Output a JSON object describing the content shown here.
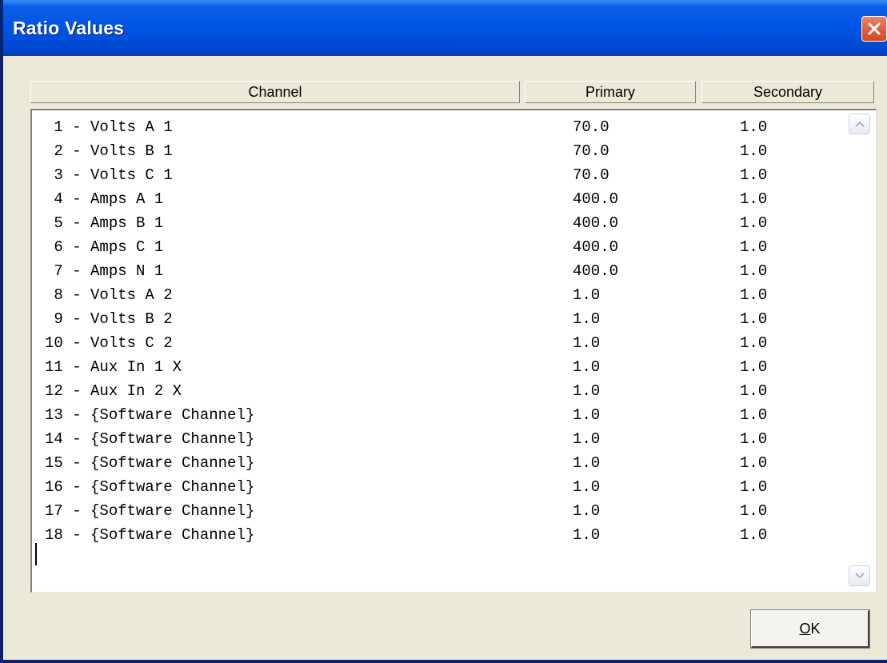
{
  "window": {
    "title": "Ratio Values"
  },
  "columns": {
    "channel": "Channel",
    "primary": "Primary",
    "secondary": "Secondary"
  },
  "rows": [
    {
      "channel": " 1 - Volts A 1",
      "primary": "70.0",
      "secondary": "1.0"
    },
    {
      "channel": " 2 - Volts B 1",
      "primary": "70.0",
      "secondary": "1.0"
    },
    {
      "channel": " 3 - Volts C 1",
      "primary": "70.0",
      "secondary": "1.0"
    },
    {
      "channel": " 4 - Amps A 1",
      "primary": "400.0",
      "secondary": "1.0"
    },
    {
      "channel": " 5 - Amps B 1",
      "primary": "400.0",
      "secondary": "1.0"
    },
    {
      "channel": " 6 - Amps C 1",
      "primary": "400.0",
      "secondary": "1.0"
    },
    {
      "channel": " 7 - Amps N 1",
      "primary": "400.0",
      "secondary": "1.0"
    },
    {
      "channel": " 8 - Volts A 2",
      "primary": "1.0",
      "secondary": "1.0"
    },
    {
      "channel": " 9 - Volts B 2",
      "primary": "1.0",
      "secondary": "1.0"
    },
    {
      "channel": "10 - Volts C 2",
      "primary": "1.0",
      "secondary": "1.0"
    },
    {
      "channel": "11 - Aux In 1 X",
      "primary": "1.0",
      "secondary": "1.0"
    },
    {
      "channel": "12 - Aux In 2 X",
      "primary": "1.0",
      "secondary": "1.0"
    },
    {
      "channel": "13 - {Software Channel}",
      "primary": "1.0",
      "secondary": "1.0"
    },
    {
      "channel": "14 - {Software Channel}",
      "primary": "1.0",
      "secondary": "1.0"
    },
    {
      "channel": "15 - {Software Channel}",
      "primary": "1.0",
      "secondary": "1.0"
    },
    {
      "channel": "16 - {Software Channel}",
      "primary": "1.0",
      "secondary": "1.0"
    },
    {
      "channel": "17 - {Software Channel}",
      "primary": "1.0",
      "secondary": "1.0"
    },
    {
      "channel": "18 - {Software Channel}",
      "primary": "1.0",
      "secondary": "1.0"
    }
  ],
  "buttons": {
    "ok_mnemonic": "O",
    "ok_rest": "K"
  },
  "icons": {
    "close": "close-x-icon",
    "scroll_up": "scroll-up-arrow-icon",
    "scroll_down": "scroll-down-arrow-icon"
  }
}
